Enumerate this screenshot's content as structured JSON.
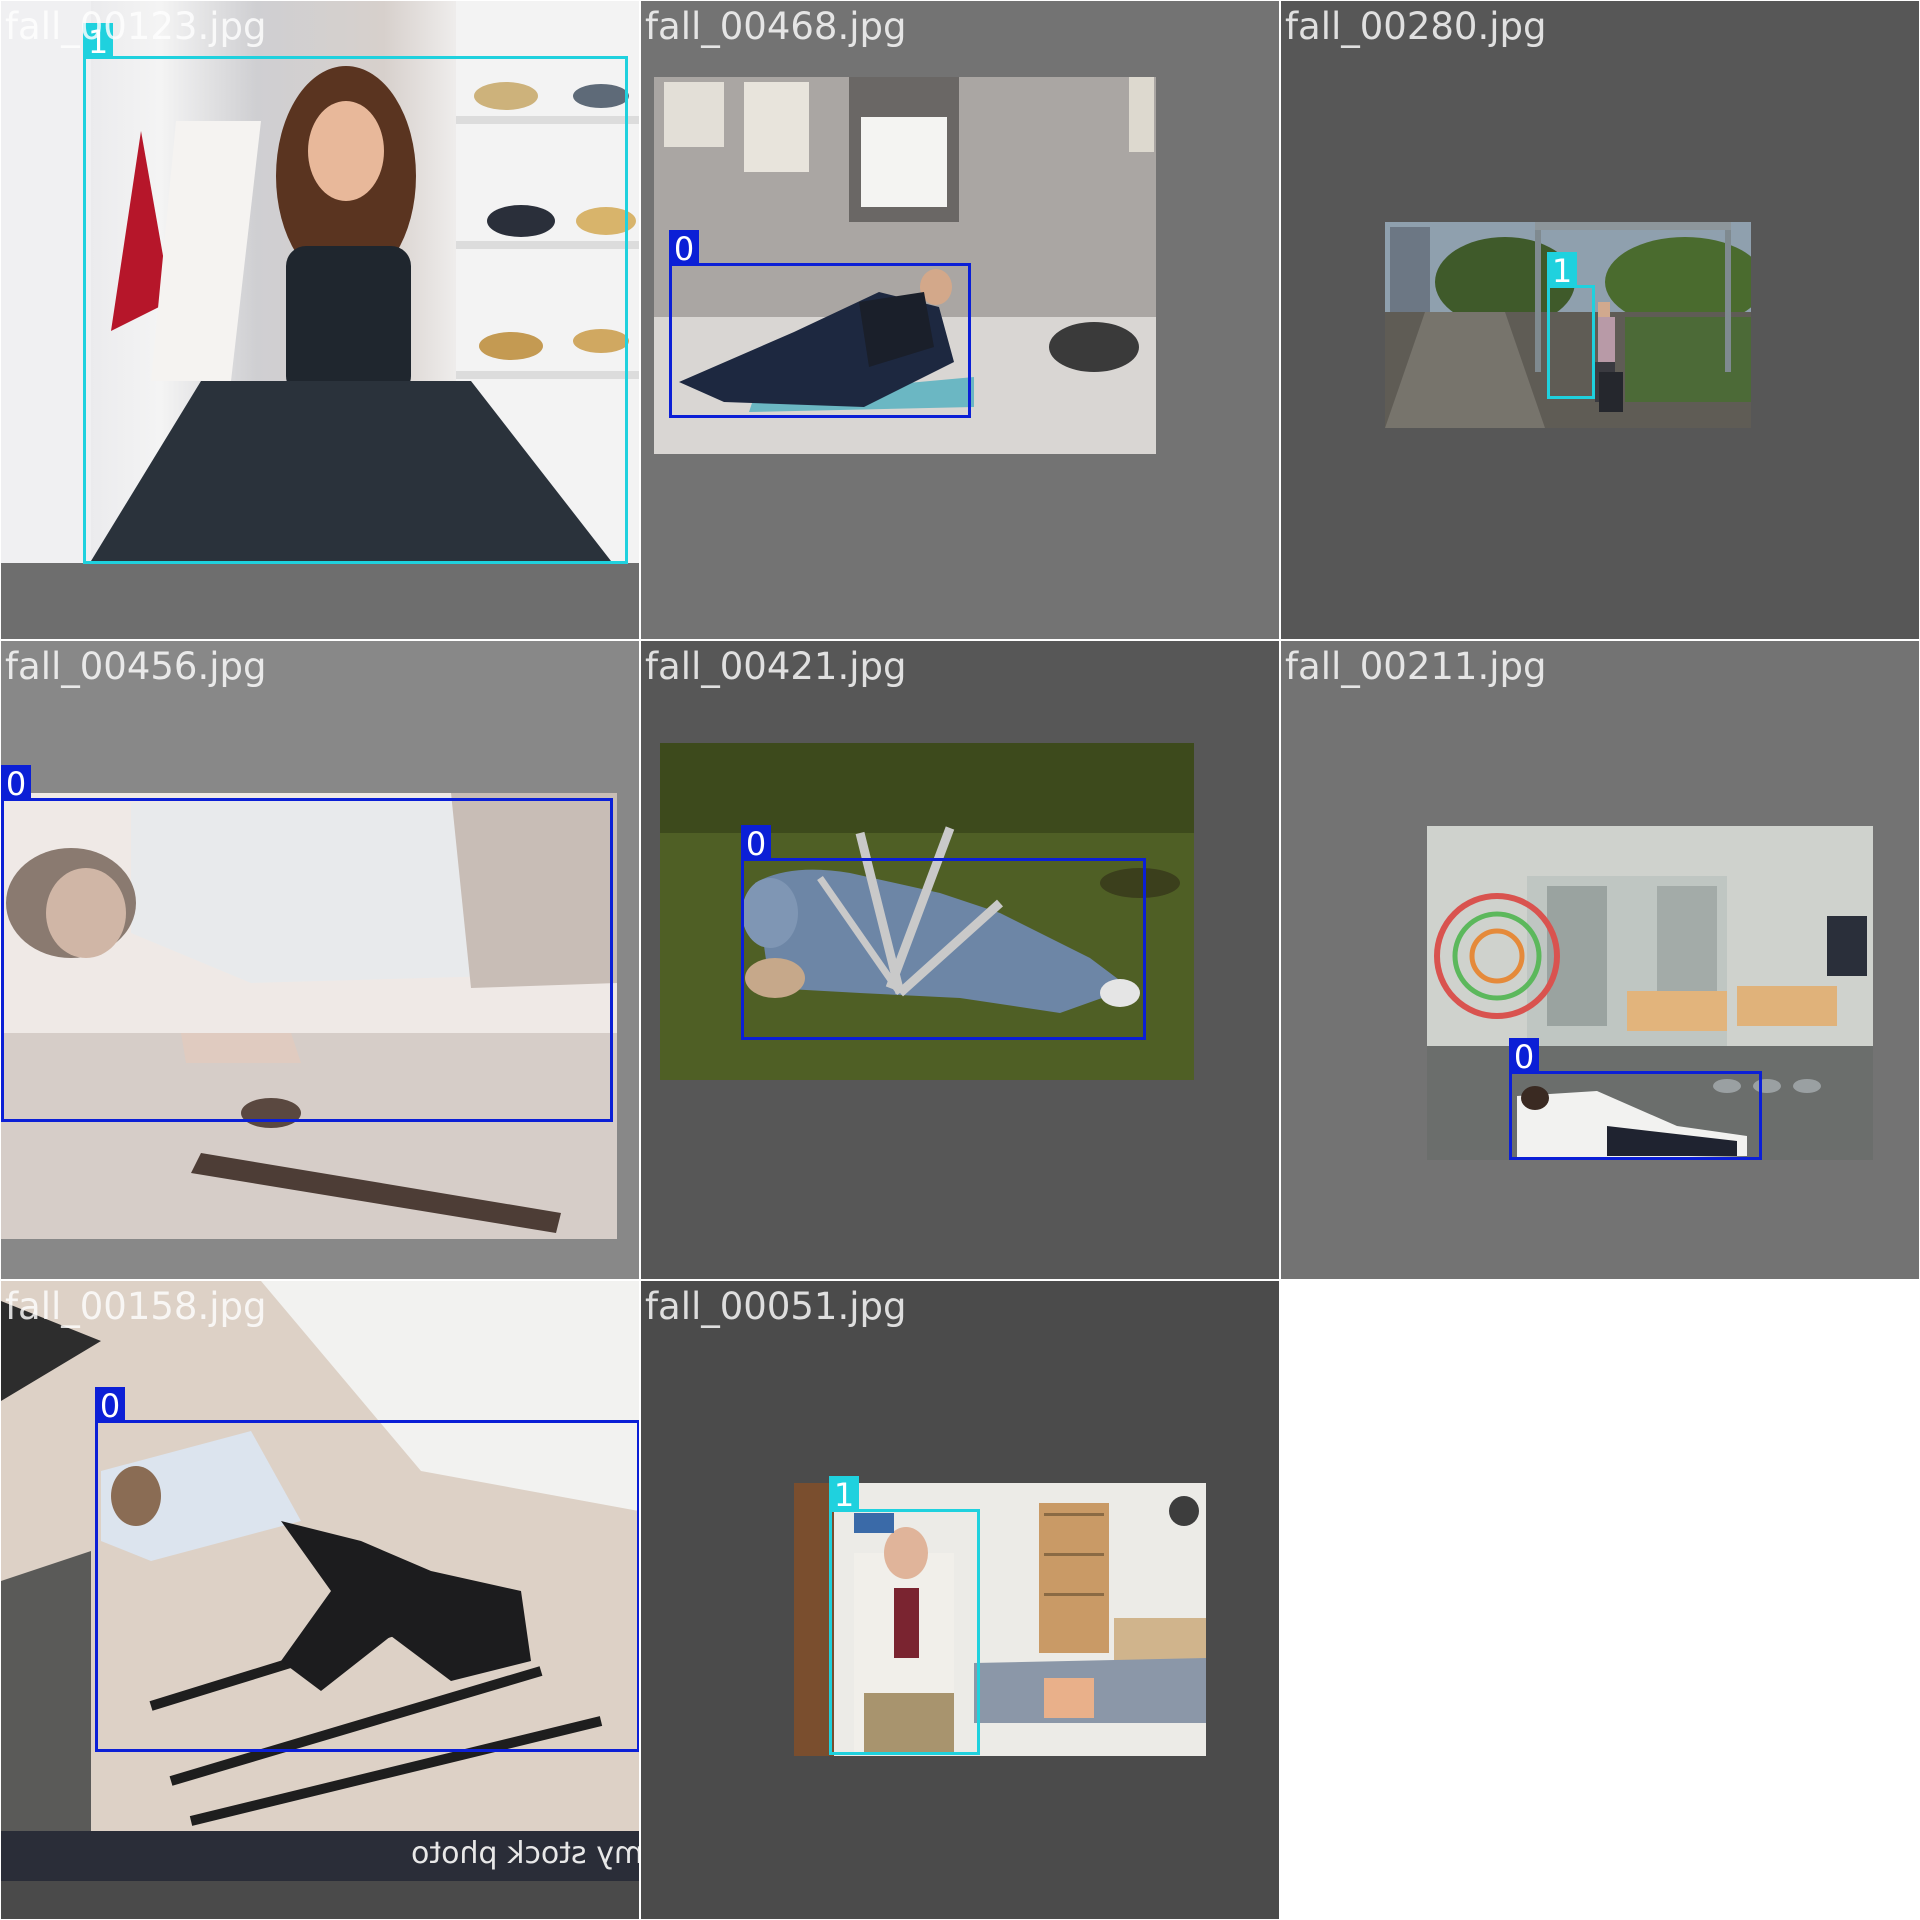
{
  "colors": {
    "class_0": "#0b1fd6",
    "class_1": "#1fd1de"
  },
  "tiles": [
    {
      "filename": "fall_00123.jpg",
      "label": "1"
    },
    {
      "filename": "fall_00468.jpg",
      "label": "0"
    },
    {
      "filename": "fall_00280.jpg",
      "label": "1"
    },
    {
      "filename": "fall_00456.jpg",
      "label": "0"
    },
    {
      "filename": "fall_00421.jpg",
      "label": "0"
    },
    {
      "filename": "fall_00211.jpg",
      "label": "0"
    },
    {
      "filename": "fall_00158.jpg",
      "label": "0",
      "watermark": "alamy stock photo"
    },
    {
      "filename": "fall_00051.jpg",
      "label": "1"
    }
  ]
}
